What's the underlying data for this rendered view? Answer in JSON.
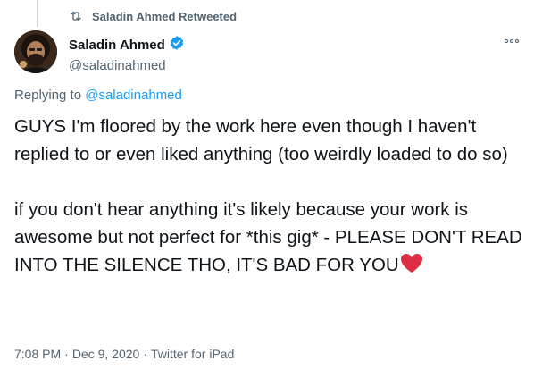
{
  "social_context": {
    "retweet_text": "Saladin Ahmed Retweeted",
    "icon": "retweet-icon"
  },
  "author": {
    "display_name": "Saladin Ahmed",
    "handle": "@saladinahmed",
    "verified": true,
    "verified_color": "#1d9bf0"
  },
  "reply": {
    "prefix": "Replying to",
    "mention": "@saladinahmed"
  },
  "tweet": {
    "paragraph_1": "GUYS I'm floored by the work here even though I haven't replied to or even liked anything (too weirdly loaded to do so)",
    "paragraph_2": "if you don't hear anything it's likely because your work is awesome but not perfect for *this gig* - PLEASE DON'T READ INTO THE SILENCE THO, IT'S BAD FOR YOU",
    "emoji": "heart-emoji",
    "emoji_color": "#dd2e44"
  },
  "meta": {
    "time": "7:08 PM",
    "separator": "·",
    "date": "Dec 9, 2020",
    "source": "Twitter for iPad"
  },
  "colors": {
    "text": "#0f1419",
    "secondary": "#536471",
    "link": "#1d9bf0"
  }
}
